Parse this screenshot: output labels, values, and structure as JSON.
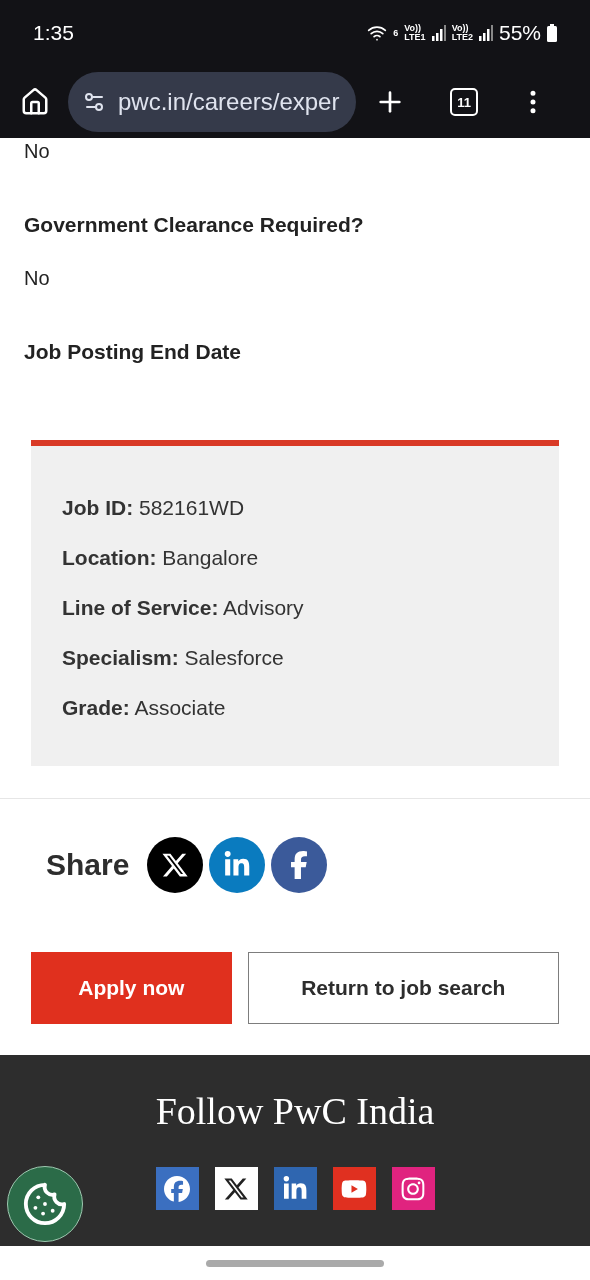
{
  "status_bar": {
    "time": "1:35",
    "wifi_badge": "6",
    "sim_1": {
      "volte": "Vo))",
      "network": "LTE1"
    },
    "sim_2": {
      "volte": "Vo))",
      "network": "LTE2"
    },
    "battery": "55%"
  },
  "browser": {
    "url": "pwc.in/careers/exper",
    "tab_count": "11"
  },
  "details": [
    {
      "kind": "value",
      "text": "No"
    },
    {
      "kind": "heading",
      "text": "Government Clearance Required?"
    },
    {
      "kind": "value",
      "text": "No"
    },
    {
      "kind": "heading",
      "text": "Job Posting End Date"
    }
  ],
  "summary": [
    {
      "label": "Job ID:",
      "value": "582161WD"
    },
    {
      "label": "Location:",
      "value": "Bangalore"
    },
    {
      "label": "Line of Service:",
      "value": "Advisory"
    },
    {
      "label": "Specialism:",
      "value": "Salesforce"
    },
    {
      "label": "Grade:",
      "value": "Associate"
    }
  ],
  "share": {
    "label": "Share",
    "networks": [
      {
        "kind": "x",
        "color": "#000000"
      },
      {
        "kind": "linkedin",
        "color": "#0a7bbf"
      },
      {
        "kind": "facebook",
        "color": "#3b5a9a"
      }
    ]
  },
  "actions": [
    {
      "kind": "primary",
      "label": "Apply now"
    },
    {
      "kind": "secondary",
      "label": "Return to job search"
    }
  ],
  "footer": {
    "title": "Follow PwC India",
    "networks": [
      {
        "kind": "facebook",
        "color": "#3b6fc0"
      },
      {
        "kind": "x",
        "color": "#ffffff"
      },
      {
        "kind": "linkedin",
        "color": "#2f66b0"
      },
      {
        "kind": "youtube",
        "color": "#e03020"
      },
      {
        "kind": "instagram",
        "color": "#e0237f"
      }
    ]
  }
}
